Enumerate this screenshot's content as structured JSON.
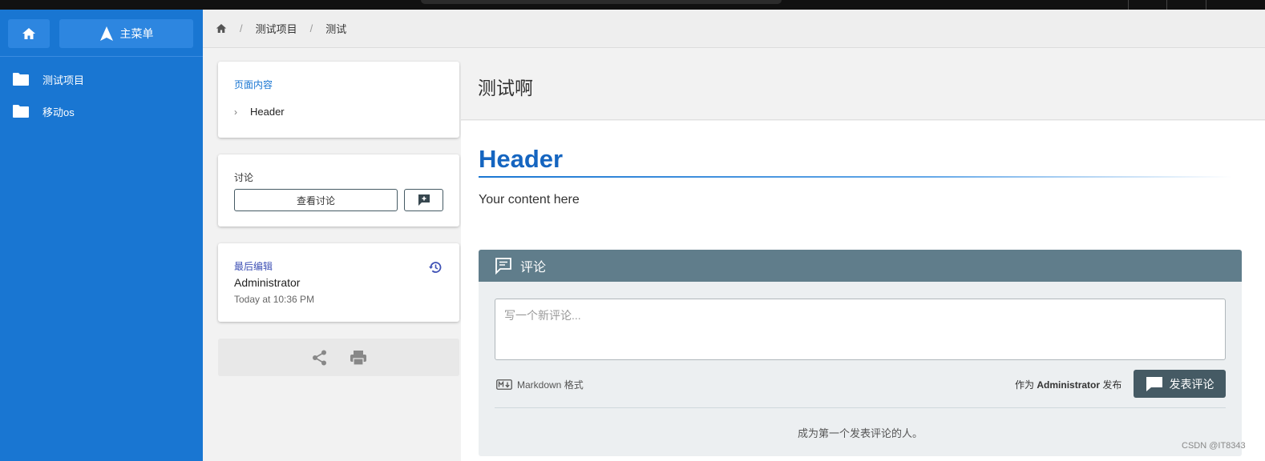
{
  "sidebar": {
    "menu_label": "主菜单",
    "items": [
      {
        "label": "测试项目"
      },
      {
        "label": "移动os"
      }
    ]
  },
  "breadcrumb": {
    "items": [
      "测试项目",
      "测试"
    ]
  },
  "toc": {
    "title": "页面内容",
    "items": [
      {
        "label": "Header"
      }
    ]
  },
  "discussion": {
    "label": "讨论",
    "view_label": "查看讨论"
  },
  "last_edit": {
    "label": "最后编辑",
    "user": "Administrator",
    "time": "Today at 10:36 PM"
  },
  "page": {
    "title": "测试啊",
    "heading": "Header",
    "body": "Your content here"
  },
  "comments": {
    "title": "评论",
    "placeholder": "写一个新评论...",
    "markdown_label": "Markdown 格式",
    "as_prefix": "作为",
    "user": "Administrator",
    "as_suffix": "发布",
    "post_label": "发表评论",
    "empty_text": "成为第一个发表评论的人。"
  },
  "watermark": "CSDN @IT8343",
  "colors": {
    "sidebar": "#1976d2",
    "heading": "#1565c0",
    "comments_header": "#607d8b",
    "post_button": "#455a64"
  }
}
